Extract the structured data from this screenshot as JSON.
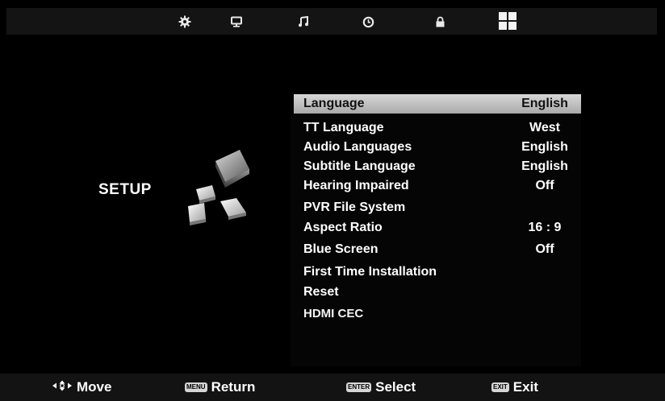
{
  "topbar": {
    "icons": [
      "gear-icon",
      "monitor-icon",
      "music-note-icon",
      "clock-icon",
      "lock-icon",
      "grid-icon"
    ],
    "active_icon": "grid-icon"
  },
  "page": {
    "title": "SETUP"
  },
  "menu": {
    "items": [
      {
        "label": "Language",
        "value": "English",
        "selected": true
      },
      {
        "label": "TT Language",
        "value": "West"
      },
      {
        "label": "Audio Languages",
        "value": "English"
      },
      {
        "label": "Subtitle Language",
        "value": "English"
      },
      {
        "label": "Hearing Impaired",
        "value": "Off"
      },
      {
        "label": "PVR File System",
        "value": ""
      },
      {
        "label": "Aspect Ratio",
        "value": "16 : 9"
      },
      {
        "label": "Blue Screen",
        "value": "Off"
      },
      {
        "label": "First Time Installation",
        "value": ""
      },
      {
        "label": "Reset",
        "value": ""
      },
      {
        "label": "HDMI CEC",
        "value": ""
      }
    ]
  },
  "footer": {
    "move": {
      "label": "Move"
    },
    "return": {
      "key": "MENU",
      "label": "Return"
    },
    "select": {
      "key": "ENTER",
      "label": "Select"
    },
    "exit": {
      "key": "EXIT",
      "label": "Exit"
    }
  },
  "colors": {
    "background": "#000000",
    "bar": "#141414",
    "highlight": "#c4c4c4",
    "text": "#ffffff"
  }
}
